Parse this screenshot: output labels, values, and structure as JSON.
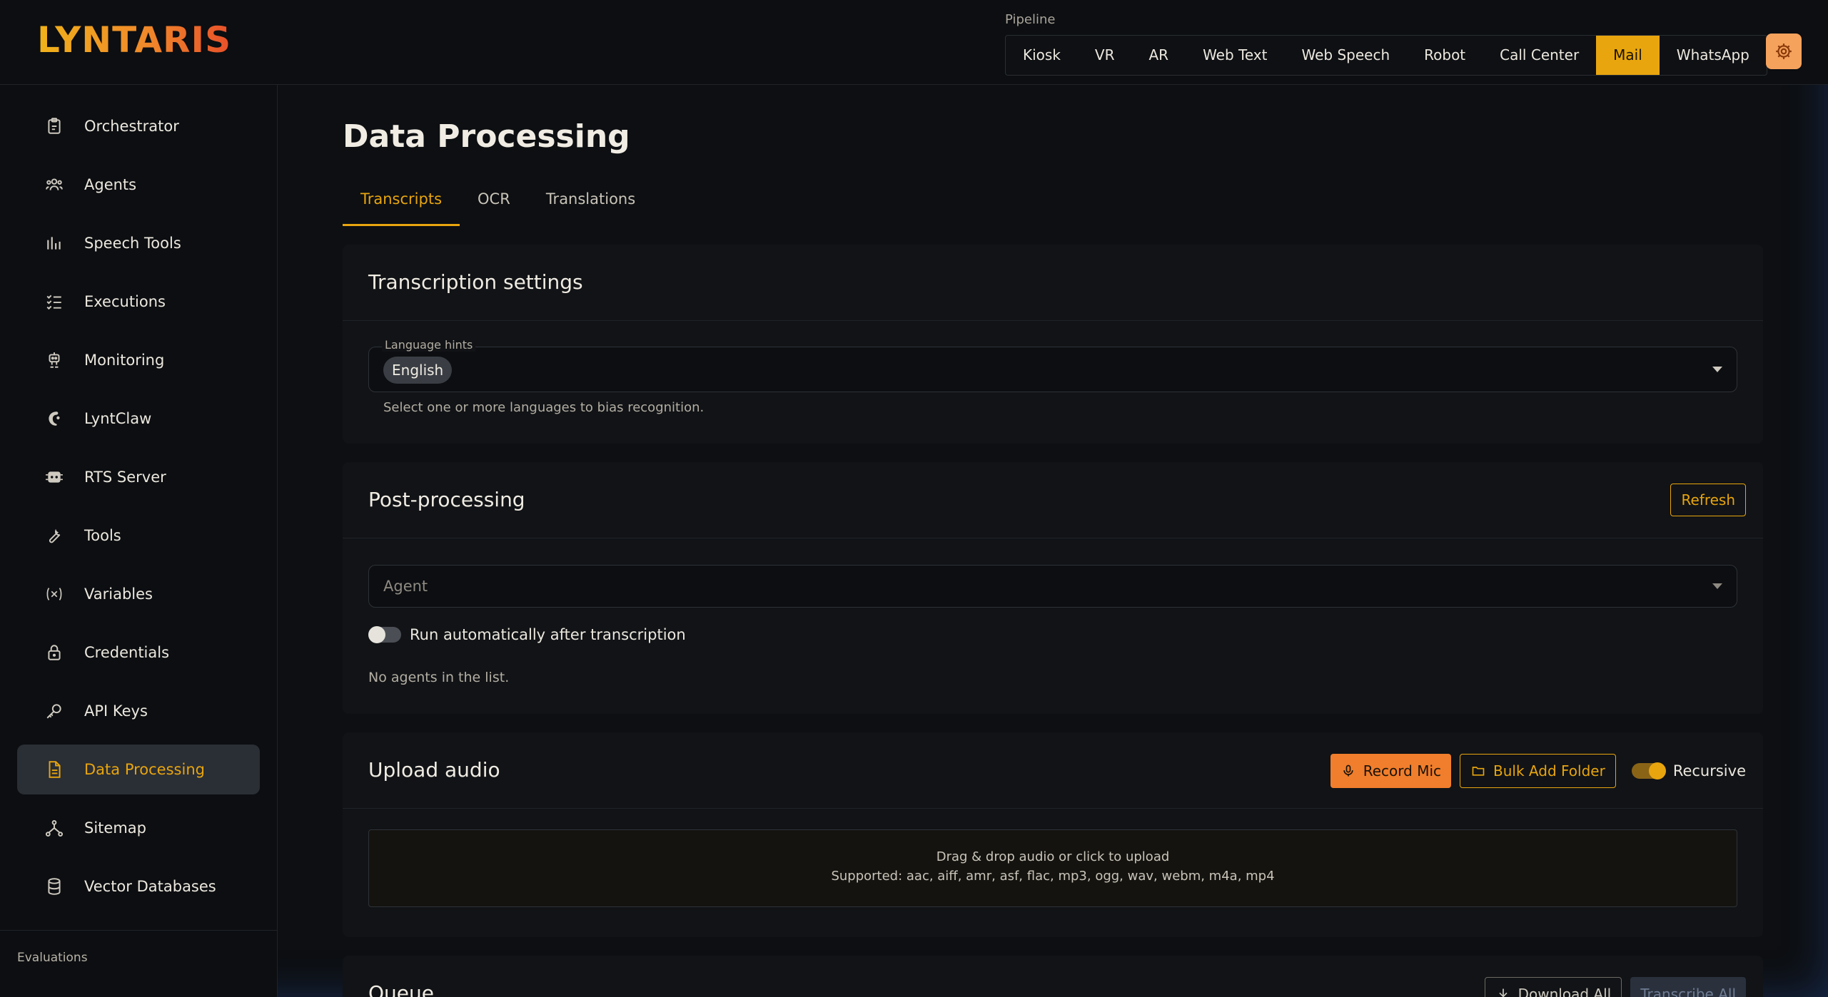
{
  "brand": {
    "logo_text": "LYNTARIS"
  },
  "pipeline": {
    "label": "Pipeline",
    "items": [
      "Kiosk",
      "VR",
      "AR",
      "Web Text",
      "Web Speech",
      "Robot",
      "Call Center",
      "Mail",
      "WhatsApp"
    ],
    "active": "Mail"
  },
  "sidebar": {
    "items": [
      {
        "label": "Orchestrator",
        "icon": "clipboard-icon"
      },
      {
        "label": "Agents",
        "icon": "users-icon"
      },
      {
        "label": "Speech Tools",
        "icon": "bar-chart-icon"
      },
      {
        "label": "Executions",
        "icon": "checklist-icon"
      },
      {
        "label": "Monitoring",
        "icon": "robot-icon"
      },
      {
        "label": "LyntClaw",
        "icon": "claw-icon"
      },
      {
        "label": "RTS Server",
        "icon": "server-icon"
      },
      {
        "label": "Tools",
        "icon": "wrench-icon"
      },
      {
        "label": "Variables",
        "icon": "variable-icon"
      },
      {
        "label": "Credentials",
        "icon": "lock-icon"
      },
      {
        "label": "API Keys",
        "icon": "key-icon"
      },
      {
        "label": "Data Processing",
        "icon": "document-icon",
        "active": true
      },
      {
        "label": "Sitemap",
        "icon": "sitemap-icon"
      },
      {
        "label": "Vector Databases",
        "icon": "database-icon"
      }
    ],
    "section_label": "Evaluations"
  },
  "main": {
    "title": "Data Processing",
    "tabs": [
      "Transcripts",
      "OCR",
      "Translations"
    ],
    "active_tab": "Transcripts",
    "transcription": {
      "title": "Transcription settings",
      "language_legend": "Language hints",
      "language_chip": "English",
      "helper": "Select one or more languages to bias recognition."
    },
    "post": {
      "title": "Post-processing",
      "refresh_label": "Refresh",
      "agent_placeholder": "Agent",
      "auto_run_label": "Run automatically after transcription",
      "auto_run_on": false,
      "empty_text": "No agents in the list."
    },
    "upload": {
      "title": "Upload audio",
      "record_label": "Record Mic",
      "bulk_label": "Bulk Add Folder",
      "recursive_label": "Recursive",
      "recursive_on": true,
      "drop_line1": "Drag & drop audio or click to upload",
      "drop_line2": "Supported: aac, aiff, amr, asf, flac, mp3, ogg, wav, webm, m4a, mp4"
    },
    "queue": {
      "title": "Queue",
      "download_label": "Download All",
      "transcribe_label": "Transcribe All"
    }
  },
  "colors": {
    "accent": "#e8a50e",
    "record": "#f07e2c"
  }
}
